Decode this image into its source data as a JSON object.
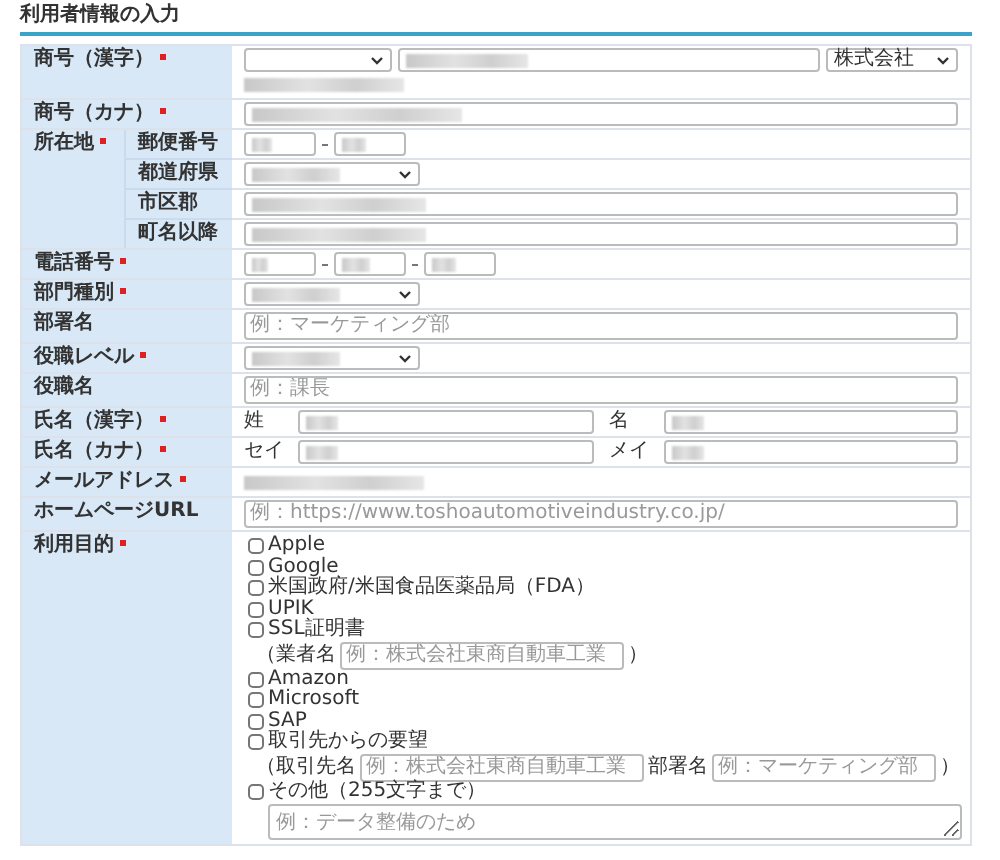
{
  "title": "利用者情報の入力",
  "rows": [
    {
      "kind": "company",
      "label": "商号（漢字）",
      "required": true,
      "prefix_blurred": false,
      "name_blurred": true,
      "suffix": "株式会社",
      "reading_blurred": true
    },
    {
      "kind": "text",
      "label": "商号（カナ）",
      "required": true,
      "blurred": true
    },
    {
      "kind": "address",
      "label": "所在地",
      "required": true,
      "parts": [
        {
          "kind": "postal",
          "label": "郵便番号",
          "blurred": true
        },
        {
          "kind": "select",
          "label": "都道府県",
          "blurred": true
        },
        {
          "kind": "text",
          "label": "市区郡",
          "blurred": true
        },
        {
          "kind": "text",
          "label": "町名以降",
          "blurred": true
        }
      ]
    },
    {
      "kind": "phone",
      "label": "電話番号",
      "required": true,
      "blurred": true
    },
    {
      "kind": "select",
      "label": "部門種別",
      "required": true,
      "blurred": true
    },
    {
      "kind": "text",
      "label": "部署名",
      "required": false,
      "blurred": false,
      "placeholder": "例：マーケティング部"
    },
    {
      "kind": "select",
      "label": "役職レベル",
      "required": true,
      "blurred": true
    },
    {
      "kind": "text",
      "label": "役職名",
      "required": false,
      "blurred": false,
      "placeholder": "例：課長"
    },
    {
      "kind": "name",
      "label": "氏名（漢字）",
      "required": true,
      "parts": [
        {
          "label": "姓",
          "blurred": true
        },
        {
          "label": "名",
          "blurred": true
        }
      ]
    },
    {
      "kind": "name",
      "label": "氏名（カナ）",
      "required": true,
      "parts": [
        {
          "label": "セイ",
          "blurred": true
        },
        {
          "label": "メイ",
          "blurred": true
        }
      ]
    },
    {
      "kind": "static",
      "label": "メールアドレス",
      "required": true,
      "blurred": true
    },
    {
      "kind": "text",
      "label": "ホームページURL",
      "required": false,
      "blurred": false,
      "placeholder": "例：https://www.toshoautomotiveindustry.co.jp/"
    },
    {
      "kind": "purposes",
      "label": "利用目的",
      "required": true,
      "textarea_placeholder": "例：データ整備のため",
      "options": [
        {
          "label": "Apple",
          "checked": false
        },
        {
          "label": "Google",
          "checked": false
        },
        {
          "label": "米国政府/米国食品医薬品局（FDA）",
          "checked": false
        },
        {
          "label": "UPIK",
          "checked": false
        },
        {
          "label": "SSL証明書",
          "checked": false,
          "extra": [
            {
              "kind": "text",
              "text": "（業者名"
            },
            {
              "kind": "input",
              "placeholder": "例：株式会社東商自動車工業"
            },
            {
              "kind": "text",
              "text": "）"
            }
          ]
        },
        {
          "label": "Amazon",
          "checked": false
        },
        {
          "label": "Microsoft",
          "checked": false
        },
        {
          "label": "SAP",
          "checked": false
        },
        {
          "label": "取引先からの要望",
          "checked": false,
          "extra": [
            {
              "kind": "text",
              "text": "（取引先名"
            },
            {
              "kind": "input",
              "placeholder": "例：株式会社東商自動車工業"
            },
            {
              "kind": "text",
              "text": "部署名"
            },
            {
              "kind": "input",
              "placeholder": "例：マーケティング部"
            },
            {
              "kind": "text",
              "text": "）"
            }
          ]
        },
        {
          "label": "その他（255文字まで）",
          "checked": false
        }
      ]
    }
  ]
}
